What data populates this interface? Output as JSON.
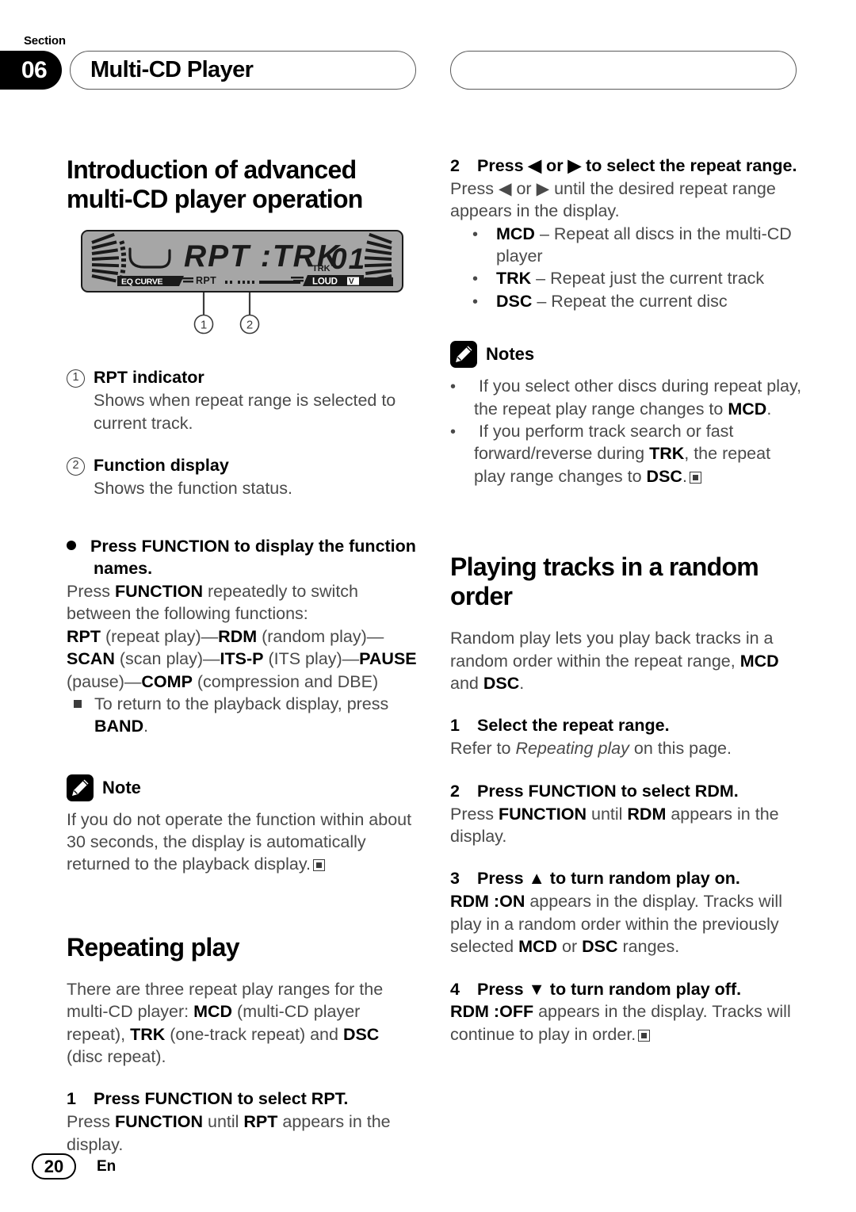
{
  "header": {
    "section_word": "Section",
    "section_number": "06",
    "title": "Multi-CD Player"
  },
  "left_column": {
    "heading": "Introduction of advanced multi-CD player operation",
    "figure": {
      "name": "head-unit-lcd-display",
      "main_text": "RPT :TRK",
      "track_label": "TRK",
      "track_number": "01",
      "eq_label": "EQ CURVE",
      "rpt_label": "RPT",
      "loud_label": "LOUD",
      "callout_1": "1",
      "callout_2": "2"
    },
    "callouts": [
      {
        "num": "1",
        "title": "RPT indicator",
        "body": "Shows when repeat range is selected to current track."
      },
      {
        "num": "2",
        "title": "Function display",
        "body": "Shows the function status."
      }
    ],
    "function_section": {
      "heading": "Press FUNCTION to display the function names.",
      "line1_a": "Press ",
      "line1_b": "FUNCTION",
      "line1_c": " repeatedly to switch between the following functions:",
      "chain": [
        {
          "bold": "RPT",
          "plain": " (repeat play)—"
        },
        {
          "bold": "RDM",
          "plain": " (random play)—"
        },
        {
          "bold": "SCAN",
          "plain": " (scan play)—"
        },
        {
          "bold": "ITS-P",
          "plain": " (ITS play)—"
        },
        {
          "bold": "PAUSE",
          "plain": " (pause)—"
        },
        {
          "bold": "COMP",
          "plain": " (compression and DBE)"
        }
      ],
      "sub_bullet_a": "To return to the playback display, press ",
      "sub_bullet_b": "BAND",
      "sub_bullet_c": "."
    },
    "note": {
      "label": "Note",
      "body": "If you do not operate the function within about 30 seconds, the display is automatically returned to the playback display."
    },
    "repeating": {
      "heading": "Repeating play",
      "intro_a": "There are three repeat play ranges for the multi-CD player: ",
      "intro_mcd": "MCD",
      "intro_b": " (multi-CD player repeat), ",
      "intro_trk": "TRK",
      "intro_c": " (one-track repeat) and ",
      "intro_dsc": "DSC",
      "intro_d": " (disc repeat).",
      "step1_num": "1",
      "step1_title": "Press FUNCTION to select RPT.",
      "step1_body_a": "Press ",
      "step1_body_b": "FUNCTION",
      "step1_body_c": " until ",
      "step1_body_d": "RPT",
      "step1_body_e": " appears in the display."
    }
  },
  "right_column": {
    "step2": {
      "num": "2",
      "title": "Press ◀ or ▶ to select the repeat range.",
      "body_a": "Press ",
      "body_arrow1": "◀",
      "body_b": " or ",
      "body_arrow2": "▶",
      "body_c": " until the desired repeat range appears in the display.",
      "options": [
        {
          "code": "MCD",
          "desc": " – Repeat all discs in the multi-CD player"
        },
        {
          "code": "TRK",
          "desc": " – Repeat just the current track"
        },
        {
          "code": "DSC",
          "desc": " – Repeat the current disc"
        }
      ]
    },
    "notes": {
      "label": "Notes",
      "items": [
        {
          "a": "If you select other discs during repeat play, the repeat play range changes to ",
          "bold": "MCD",
          "c": ".",
          "has_end": false
        },
        {
          "a": "If you perform track search or fast forward/reverse during ",
          "bold": "TRK",
          "c": ", the repeat play range changes to ",
          "bold2": "DSC",
          "d": ".",
          "has_end": true
        }
      ]
    },
    "random": {
      "heading": "Playing tracks in a random order",
      "intro_a": "Random play lets you play back tracks in a random order within the repeat range, ",
      "intro_mcd": "MCD",
      "intro_b": " and ",
      "intro_dsc": "DSC",
      "intro_c": ".",
      "steps": [
        {
          "num": "1",
          "title": "Select the repeat range.",
          "body_a": "Refer to ",
          "body_italic": "Repeating play",
          "body_b": " on this page."
        },
        {
          "num": "2",
          "title": "Press FUNCTION to select RDM.",
          "body_a": "Press ",
          "body_bold1": "FUNCTION",
          "body_b": " until ",
          "body_bold2": "RDM",
          "body_c": " appears in the display."
        },
        {
          "num": "3",
          "title": "Press ▲ to turn random play on.",
          "body_bold1": "RDM :ON",
          "body_a": " appears in the display. Tracks will play in a random order within the previously selected ",
          "body_bold2": "MCD",
          "body_b": " or ",
          "body_bold3": "DSC",
          "body_c": " ranges."
        },
        {
          "num": "4",
          "title": "Press ▼ to turn random play off.",
          "body_bold1": "RDM :OFF",
          "body_a": " appears in the display. Tracks will continue to play in order."
        }
      ]
    }
  },
  "footer": {
    "page_number": "20",
    "language": "En"
  }
}
